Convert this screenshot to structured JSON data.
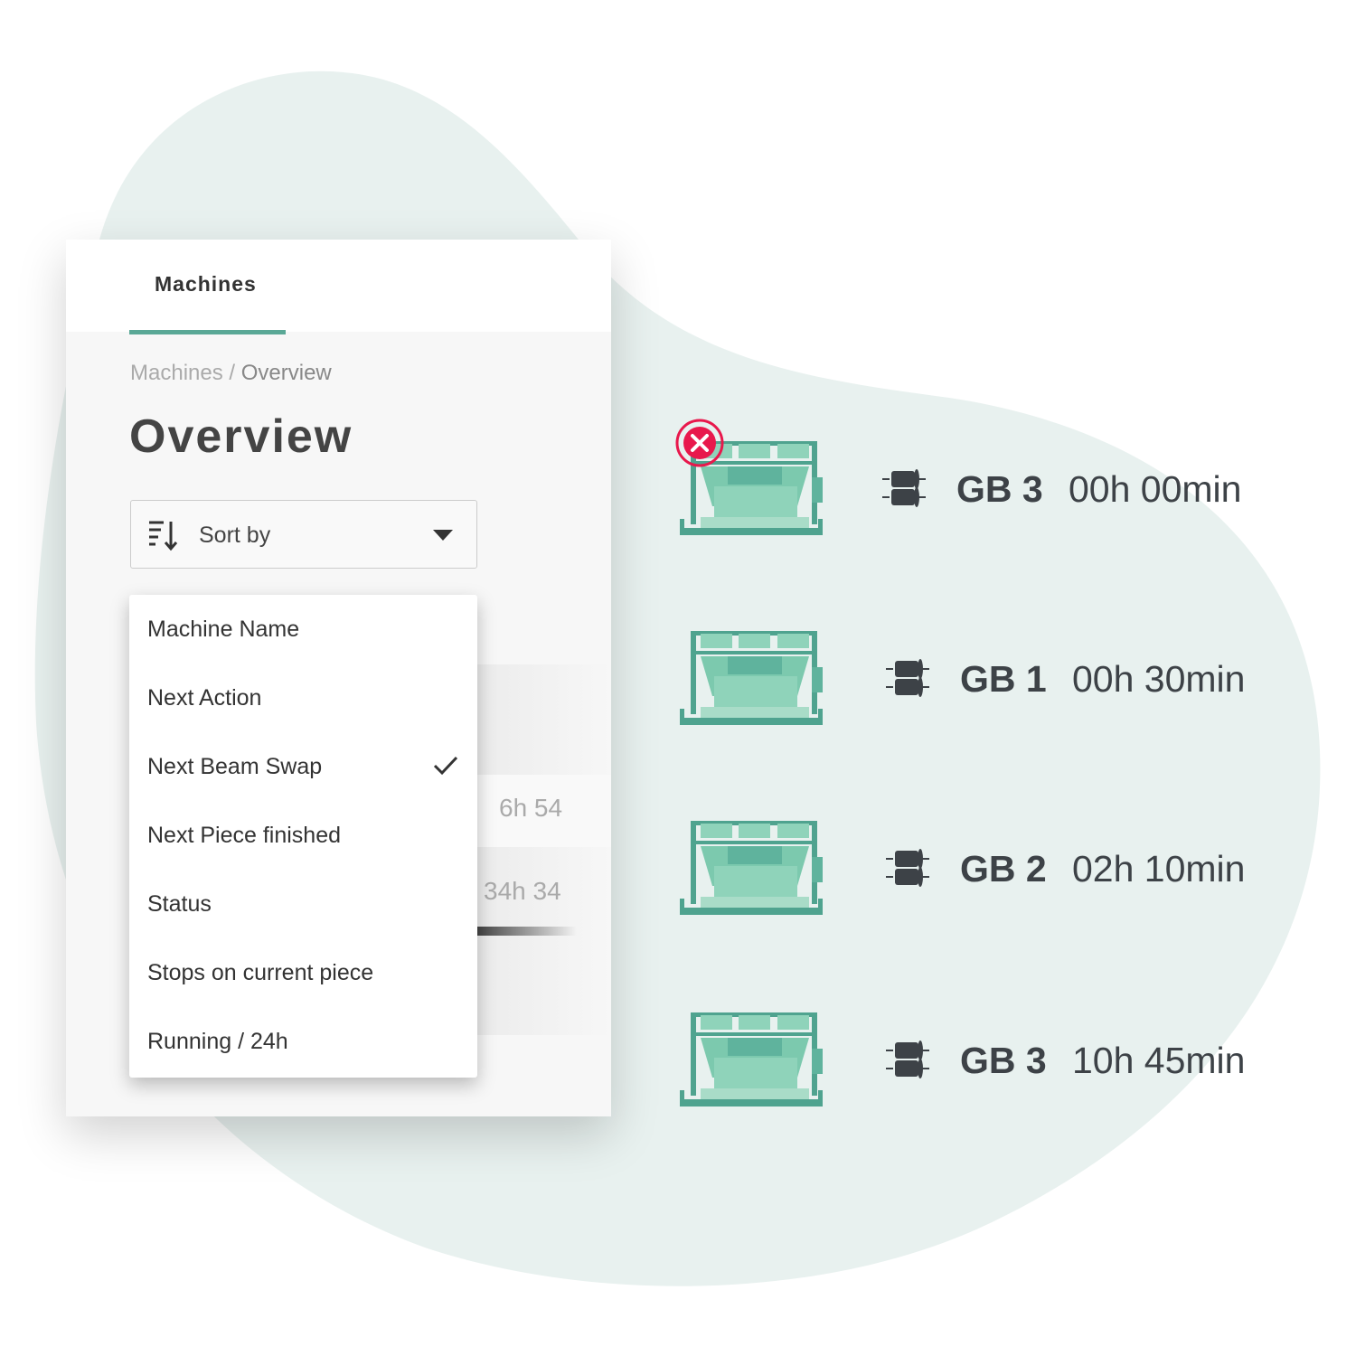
{
  "colors": {
    "accent": "#5aa896",
    "loom": "#8fd3ba",
    "loom_dark": "#4fa38f",
    "error": "#e8184c",
    "blob": "#e8f1ef"
  },
  "tabs": [
    {
      "label": "Machines",
      "active": true
    }
  ],
  "breadcrumb": {
    "parent": "Machines",
    "separator": " / ",
    "current": "Overview"
  },
  "page_title": "Overview",
  "sort": {
    "label": "Sort by",
    "icon": "sort-icon"
  },
  "sort_menu": {
    "items": [
      {
        "label": "Machine Name",
        "selected": false
      },
      {
        "label": "Next Action",
        "selected": false
      },
      {
        "label": "Next Beam Swap",
        "selected": true
      },
      {
        "label": "Next Piece finished",
        "selected": false
      },
      {
        "label": "Status",
        "selected": false
      },
      {
        "label": "Stops on current piece",
        "selected": false
      },
      {
        "label": "Running / 24h",
        "selected": false
      }
    ]
  },
  "background_values": [
    "6h 54",
    "34h 34"
  ],
  "machines": [
    {
      "name": "GB 3",
      "time": "00h 00min",
      "status": "error"
    },
    {
      "name": "GB 1",
      "time": "00h 30min",
      "status": "ok"
    },
    {
      "name": "GB 2",
      "time": "02h 10min",
      "status": "ok"
    },
    {
      "name": "GB 3",
      "time": "10h 45min",
      "status": "ok"
    }
  ]
}
